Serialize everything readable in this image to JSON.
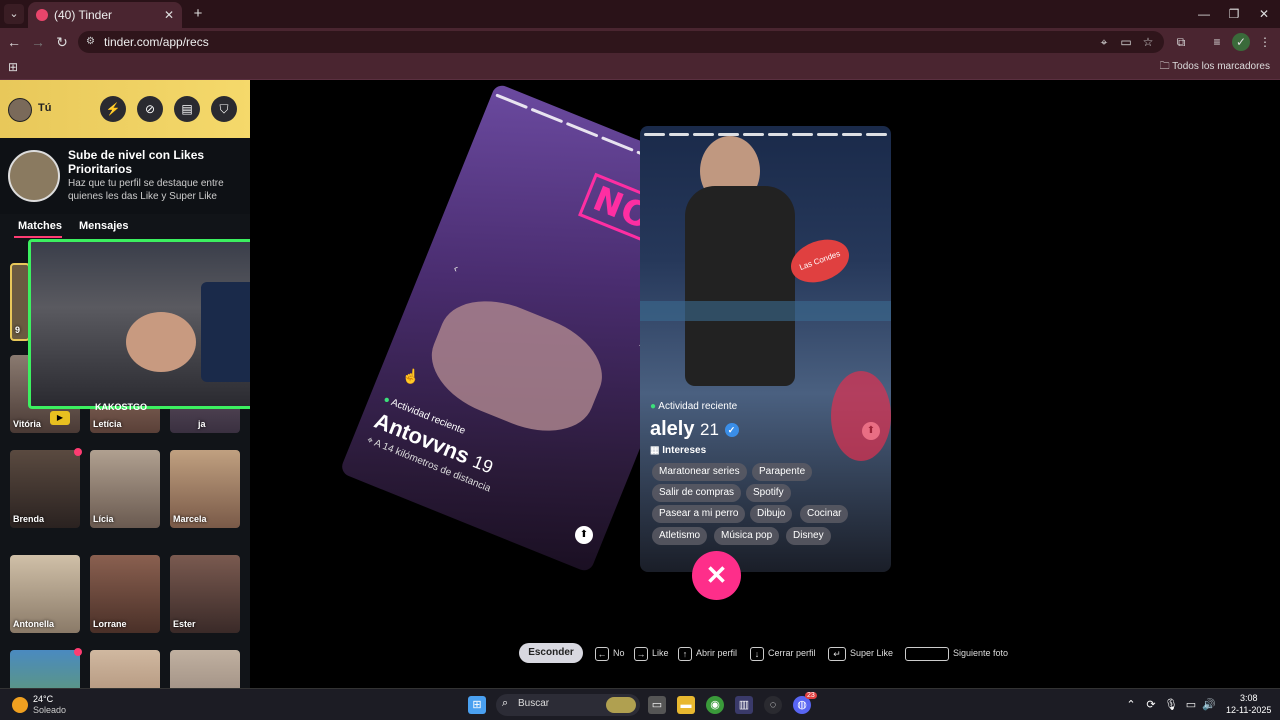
{
  "browser": {
    "tab_title": "(40) Tinder",
    "url": "tinder.com/app/recs",
    "bookmarks_all": "Todos los marcadores"
  },
  "sidebar": {
    "me_label": "Tú",
    "promo_title": "Sube de nivel con Likes Prioritarios",
    "promo_desc": "Haz que tu perfil se destaque entre quienes les das Like y Super Like",
    "tabs": [
      "Matches",
      "Mensajes"
    ],
    "cards": [
      {
        "name": "9"
      },
      {
        "name": "Vitória"
      },
      {
        "name": "Letícia"
      },
      {
        "name": "ja"
      },
      {
        "name": "Brenda"
      },
      {
        "name": "Lícia"
      },
      {
        "name": "Marcela"
      },
      {
        "name": "Antonella"
      },
      {
        "name": "Lorrane"
      },
      {
        "name": "Ester"
      }
    ]
  },
  "overlay": {
    "streamer_name": "KAKOSTGO"
  },
  "nope_card": {
    "stamp": "NOPE",
    "activity": "Actividad reciente",
    "name": "Antovvns",
    "age": "19",
    "distance": "A 14 kilómetros de distancia"
  },
  "profile_card": {
    "activity": "Actividad reciente",
    "name": "alely",
    "age": "21",
    "interests_label": "Intereses",
    "interests": [
      "Maratonear series",
      "Parapente",
      "Salir de compras",
      "Spotify",
      "Pasear a mi perro",
      "Dibujo",
      "Cocinar",
      "Atletismo",
      "Música pop",
      "Disney"
    ],
    "sign_text": "Las Condes"
  },
  "shortcuts": {
    "hide": "Esconder",
    "no": "No",
    "like": "Like",
    "open": "Abrir perfil",
    "close": "Cerrar perfil",
    "super": "Super Like",
    "next": "Siguiente foto"
  },
  "taskbar": {
    "temp": "24°C",
    "weather": "Soleado",
    "search": "Buscar",
    "time": "3:08",
    "date": "12-11-2025",
    "discord_badge": "23"
  },
  "colors": {
    "tinder_pink": "#fe3c72",
    "nope_pink": "#fe2ea2",
    "header_gold": "#f5d96b",
    "browser_maroon": "#4a2530"
  }
}
